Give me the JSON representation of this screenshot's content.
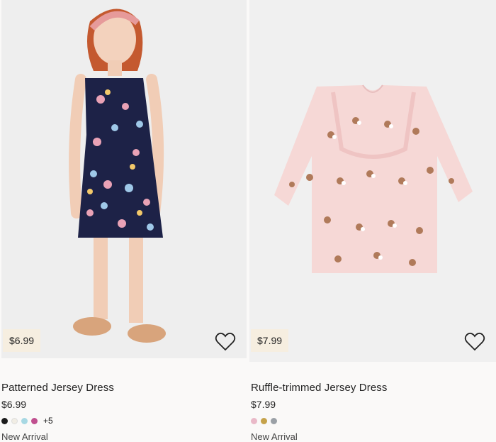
{
  "products": [
    {
      "name": "Patterned Jersey Dress",
      "price": "$6.99",
      "badge_price": "$6.99",
      "swatches": [
        "#1b1b1b",
        "#f1ede4",
        "#a7d8e3",
        "#c04f8f"
      ],
      "more_colors": "+5",
      "marker": "New Arrival",
      "image_icon": "girl-in-butterfly-dress-image",
      "favorite_icon": "heart-outline-icon"
    },
    {
      "name": "Ruffle-trimmed Jersey Dress",
      "price": "$7.99",
      "badge_price": "$7.99",
      "swatches": [
        "#e9b9c8",
        "#c5a24a",
        "#9aa0a6"
      ],
      "more_colors": "",
      "marker": "New Arrival",
      "image_icon": "pink-bunny-dress-image",
      "favorite_icon": "heart-outline-icon"
    }
  ],
  "colors": {
    "badge_bg": "#f6eee0",
    "navy_dress": "#1d2247",
    "pink_dress": "#f6d8d6"
  }
}
